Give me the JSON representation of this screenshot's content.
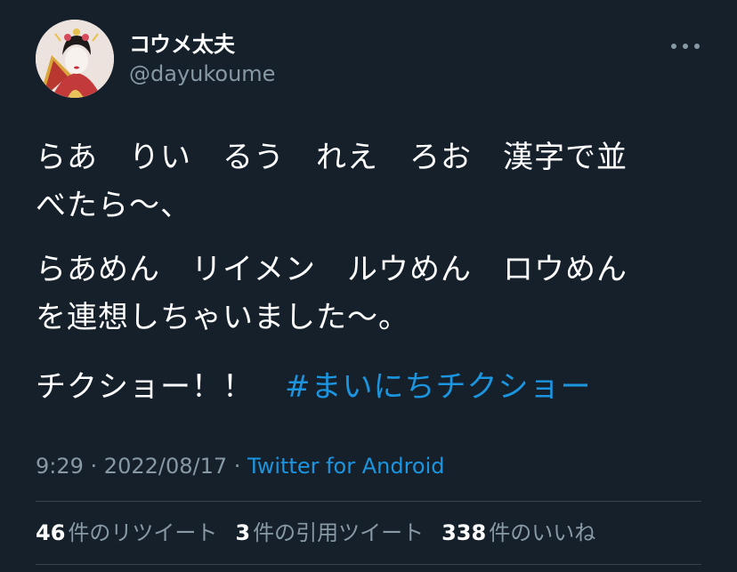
{
  "user": {
    "display_name": "コウメ太夫",
    "handle": "@dayukoume",
    "avatar_icon": "avatar-portrait"
  },
  "tweet": {
    "line1": "らあ　りい　るう　れえ　ろお　漢字で並",
    "line2": "べたら〜、",
    "line3": "らあめん　リイメン　ルウめん　ロウめん",
    "line4": "を連想しちゃいました〜。",
    "line5_text": "チクショー！！　",
    "hashtag": "#まいにちチクショー"
  },
  "meta": {
    "time": "9:29",
    "date": "2022/08/17",
    "separator": " · ",
    "source": "Twitter for Android"
  },
  "stats": {
    "retweets_count": "46",
    "retweets_label": "件のリツイート",
    "quotes_count": "3",
    "quotes_label": "件の引用ツイート",
    "likes_count": "338",
    "likes_label": "件のいいね"
  },
  "colors": {
    "background": "#15202b",
    "link": "#1b95e0",
    "secondary_text": "#8899a6",
    "divider": "#38444d"
  }
}
